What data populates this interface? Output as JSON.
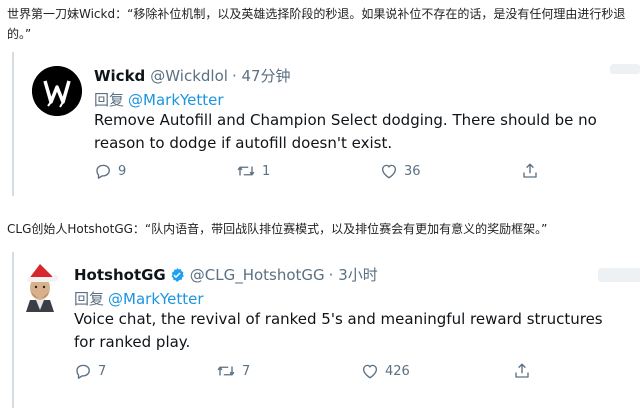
{
  "caption1": "世界第一刀妹Wickd：“移除补位机制，以及英雄选择阶段的秒退。如果说补位不存在的话，是没有任何理由进行秒退的。”",
  "caption2": "CLG创始人HotshotGG：“队内语音，带回战队排位赛模式，以及排位赛会有更加有意义的奖励框架。”",
  "tweets": [
    {
      "name": "Wickd",
      "handle": "@Wickdlol",
      "time": "· 47分钟",
      "reply_prefix": "回复",
      "reply_to": "@MarkYetter",
      "text": "Remove Autofill and Champion Select dodging. There should be no reason to dodge if autofill doesn't exist.",
      "replies": "9",
      "retweets": "1",
      "likes": "36"
    },
    {
      "name": "HotshotGG",
      "handle": "@CLG_HotshotGG",
      "time": "· 3小时",
      "reply_prefix": "回复",
      "reply_to": "@MarkYetter",
      "text": "Voice chat, the revival of ranked 5's and meaningful reward structures for ranked play.",
      "replies": "7",
      "retweets": "7",
      "likes": "426"
    }
  ],
  "colors": {
    "link": "#1b95e0",
    "muted": "#5b7083",
    "text": "#0f1419",
    "verified": "#1da1f2"
  },
  "icons": [
    "reply-icon",
    "retweet-icon",
    "like-icon",
    "share-icon",
    "verified-badge-icon"
  ]
}
